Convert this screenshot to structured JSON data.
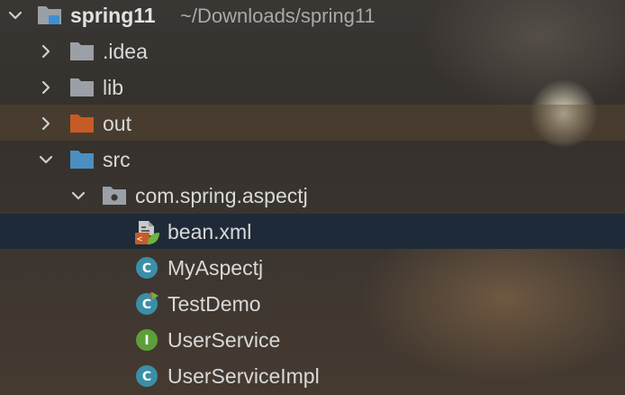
{
  "tree": {
    "project": {
      "name": "spring11",
      "path": "~/Downloads/spring11",
      "icon": "project-folder-icon"
    },
    "items": [
      {
        "label": ".idea",
        "icon": "folder-icon",
        "expanded": false
      },
      {
        "label": "lib",
        "icon": "folder-icon",
        "expanded": false
      },
      {
        "label": "out",
        "icon": "excluded-folder-icon",
        "expanded": false,
        "color": "#c75b26"
      },
      {
        "label": "src",
        "icon": "source-folder-icon",
        "expanded": true,
        "color": "#4a8fc0"
      },
      {
        "label": "com.spring.aspectj",
        "icon": "package-icon",
        "expanded": true
      },
      {
        "label": "bean.xml",
        "icon": "spring-xml-icon",
        "selected": true
      },
      {
        "label": "MyAspectj",
        "icon": "class-icon",
        "badge": "C"
      },
      {
        "label": "TestDemo",
        "icon": "runnable-class-icon",
        "badge": "C"
      },
      {
        "label": "UserService",
        "icon": "interface-icon",
        "badge": "I"
      },
      {
        "label": "UserServiceImpl",
        "icon": "class-icon",
        "badge": "C"
      }
    ]
  },
  "colors": {
    "class": "#3a8fa8",
    "interface": "#5d9e3a",
    "selection": "#1f2a38",
    "folder": "#9aa0a6",
    "excluded": "#c75b26",
    "source": "#4a8fc0"
  }
}
